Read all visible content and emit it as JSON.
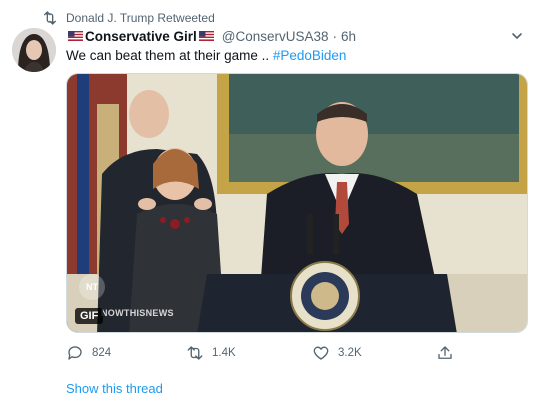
{
  "retweet_banner": {
    "text": "Donald J. Trump Retweeted",
    "icon": "retweet-icon"
  },
  "author": {
    "display_name": "Conservative Girl",
    "handle": "@ConservUSA38",
    "separator": "·",
    "time": "6h",
    "flag_icon": "us-flag-icon"
  },
  "tweet": {
    "text": "We can beat them at their game ..",
    "hashtag": "#PedoBiden"
  },
  "media": {
    "badge": "GIF",
    "watermark": "NOWTHISNEWS",
    "logo": "NT"
  },
  "actions": {
    "replies": "824",
    "retweets": "1.4K",
    "likes": "3.2K"
  },
  "show_thread_label": "Show this thread",
  "colors": {
    "link": "#1d9bf0",
    "secondary": "#536471",
    "text": "#0f1419"
  }
}
